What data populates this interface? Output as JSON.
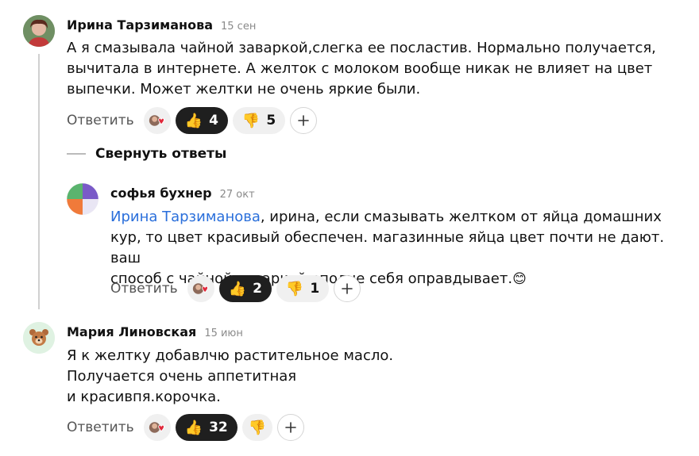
{
  "comments": [
    {
      "author": "Ирина Тарзиманова",
      "date": "15 сен",
      "text": "А я смазывала чайной заваркой,слегка ее посластив. Нормально получается,\nвычитала в интернете. А желток с молоком вообще никак не влияет на цвет\nвыпечки. Может желтки не очень яркие были.",
      "reply_label": "Ответить",
      "likes": "4",
      "dislikes": "5"
    },
    {
      "author": "софья бухнер",
      "date": "27 окт",
      "mention": "Ирина Тарзиманова",
      "text": ", ирина, если смазывать желтком от яйца домашних\nкур, то цвет красивый обеспечен. магазинные яйца цвет почти не дают. ваш\nспособ с чайной заваркой вполне себя оправдывает.",
      "emoji": "😊",
      "reply_label": "Ответить",
      "likes": "2",
      "dislikes": "1"
    },
    {
      "author": "Мария Линовская",
      "date": "15 июн",
      "text": "Я к желтку добавлчю растительное масло.\nПолучается очень аппетитная\nи красивпя.корочка.",
      "reply_label": "Ответить",
      "likes": "32",
      "dislikes": ""
    }
  ],
  "collapse_label": "Свернуть ответы",
  "colors": {
    "like_bg": "#1f1f1f",
    "pill_bg": "#f0f0f0",
    "mention": "#2a6fdb"
  },
  "icons": {
    "like": "thumbs-up-icon",
    "dislike": "thumbs-down-icon",
    "add": "plus-icon",
    "reactors": "reactor-avatars-icon"
  }
}
